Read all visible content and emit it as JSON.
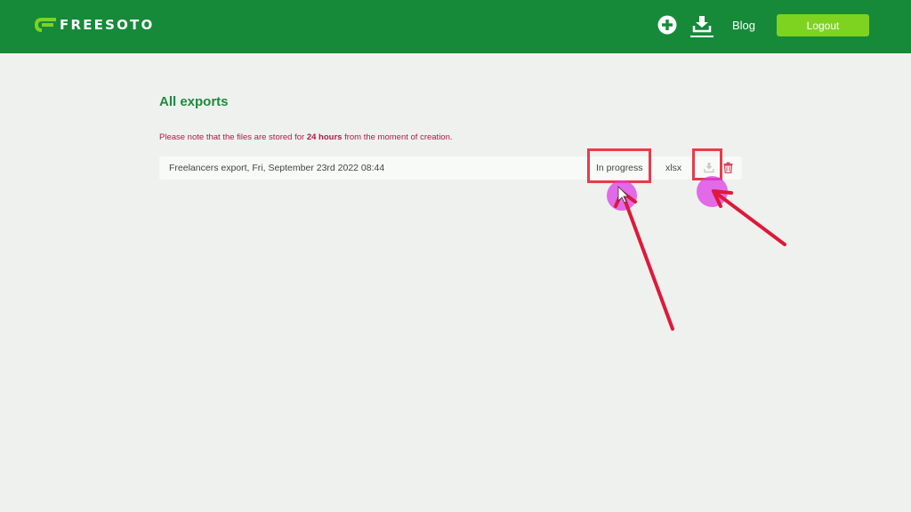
{
  "header": {
    "logo_text": "FREESOTO",
    "add_icon": "plus-circle",
    "download_icon": "tray-download",
    "blog_label": "Blog",
    "logout_label": "Logout",
    "colors": {
      "bar": "#168a39",
      "logout_button": "#7ed321"
    }
  },
  "main": {
    "title": "All exports",
    "notice": {
      "before": "Please note that the files are stored for ",
      "emphasis": "24 hours",
      "after": " from the moment of creation."
    },
    "exports": [
      {
        "name": "Freelancers export, Fri, September 23rd 2022  08:44",
        "status": "In progress",
        "format": "xlsx",
        "download_icon": "download-icon",
        "delete_icon": "trash-icon"
      }
    ]
  },
  "annotations": {
    "highlight_color": "#e83b4a",
    "click_marker_color": "#dc3ce6"
  }
}
